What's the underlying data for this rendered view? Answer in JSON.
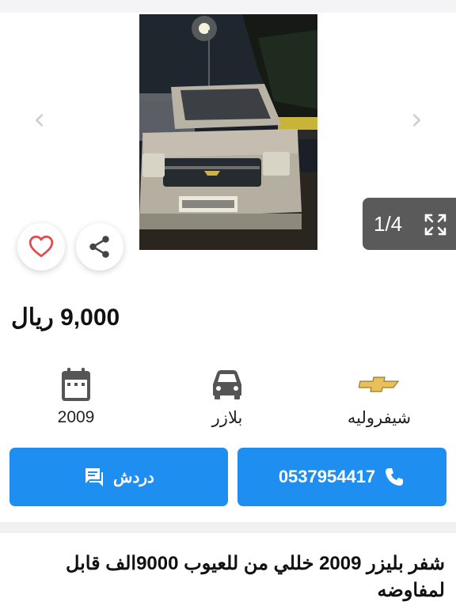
{
  "gallery": {
    "counter": "1/4",
    "prev_icon": "chevron-left-icon",
    "next_icon": "chevron-right-icon",
    "expand_icon": "expand-icon"
  },
  "actions": {
    "favorite_icon": "heart-icon",
    "share_icon": "share-icon"
  },
  "listing": {
    "price": "9,000 ريال",
    "specs": {
      "year": "2009",
      "model": "بلازر",
      "make": "شيفروليه"
    },
    "description": "شفر بليزر 2009 خللي من للعيوب 9000الف قابل لمفاوضه"
  },
  "contact": {
    "chat_label": "دردش",
    "phone_label": "0537954417"
  },
  "colors": {
    "accent": "#1e8ff0",
    "heart": "#e5484d",
    "counter_bg": "#5a5a5a"
  }
}
